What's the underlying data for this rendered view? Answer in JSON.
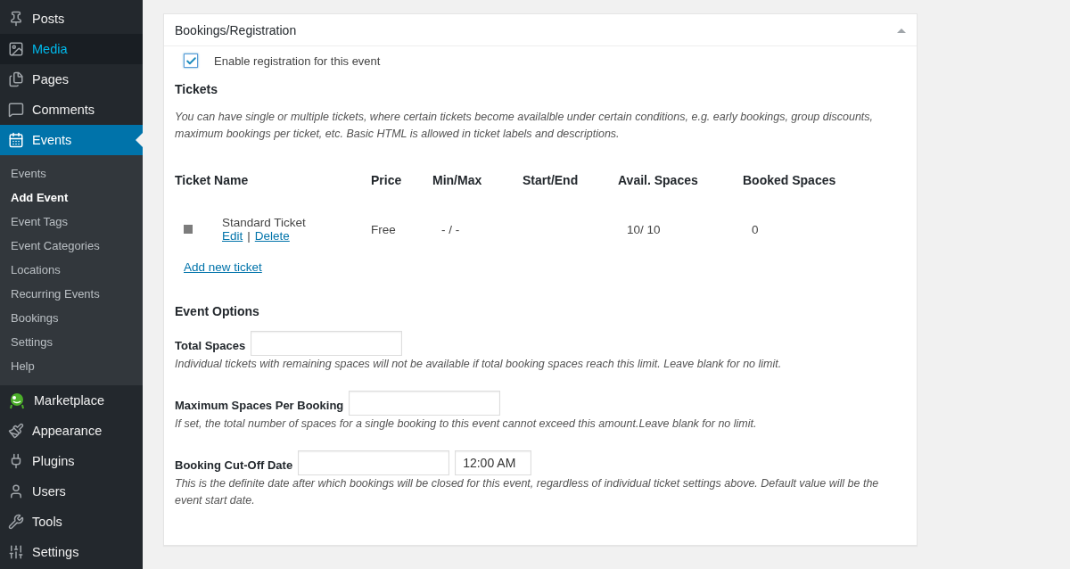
{
  "sidebar": {
    "items": [
      {
        "label": "Posts",
        "selected": false,
        "hovered": false
      },
      {
        "label": "Media",
        "selected": false,
        "hovered": true
      },
      {
        "label": "Pages",
        "selected": false,
        "hovered": false
      },
      {
        "label": "Comments",
        "selected": false,
        "hovered": false
      },
      {
        "label": "Events",
        "selected": true,
        "hovered": false,
        "children": [
          {
            "label": "Events",
            "selected": false
          },
          {
            "label": "Add Event",
            "selected": true
          },
          {
            "label": "Event Tags",
            "selected": false
          },
          {
            "label": "Event Categories",
            "selected": false
          },
          {
            "label": "Locations",
            "selected": false
          },
          {
            "label": "Recurring Events",
            "selected": false
          },
          {
            "label": "Bookings",
            "selected": false
          },
          {
            "label": "Settings",
            "selected": false
          },
          {
            "label": "Help",
            "selected": false
          }
        ]
      },
      {
        "label": "Marketplace",
        "selected": false,
        "hovered": false
      },
      {
        "label": "Appearance",
        "selected": false,
        "hovered": false
      },
      {
        "label": "Plugins",
        "selected": false,
        "hovered": false
      },
      {
        "label": "Users",
        "selected": false,
        "hovered": false
      },
      {
        "label": "Tools",
        "selected": false,
        "hovered": false
      },
      {
        "label": "Settings",
        "selected": false,
        "hovered": false
      }
    ]
  },
  "panel": {
    "title": "Bookings/Registration",
    "expanded": true,
    "enable_registration": {
      "label": "Enable registration for this event",
      "checked": true
    },
    "tickets": {
      "heading": "Tickets",
      "description": "You can have single or multiple tickets, where certain tickets become availalble under certain conditions, e.g. early bookings, group discounts, maximum bookings per ticket, etc. Basic HTML is allowed in ticket labels and descriptions.",
      "columns": [
        "Ticket Name",
        "Price",
        "Min/Max",
        "Start/End",
        "Avail. Spaces",
        "Booked Spaces"
      ],
      "rows": [
        {
          "name": "Standard Ticket",
          "edit": "Edit",
          "separator": "|",
          "delete": "Delete",
          "price": "Free",
          "min_max": "- / -",
          "avail": "10/ 10",
          "booked": "0"
        }
      ],
      "add_link": "Add new ticket"
    },
    "options": {
      "heading": "Event Options",
      "fields": [
        {
          "label": "Total Spaces",
          "inputs": [
            {
              "kind": "wide"
            }
          ],
          "help": "Individual tickets with remaining spaces will not be available if total booking spaces reach this limit. Leave blank for no limit."
        },
        {
          "label": "Maximum Spaces Per Booking",
          "inputs": [
            {
              "kind": "wide"
            }
          ],
          "help": "If set, the total number of spaces for a single booking to this event cannot exceed this amount.Leave blank for no limit."
        },
        {
          "label": "Booking Cut-Off Date",
          "inputs": [
            {
              "kind": "wide"
            },
            {
              "kind": "narrow",
              "value": "12:00 AM"
            }
          ],
          "help": "This is the definite date after which bookings will be closed for this event, regardless of individual ticket settings above. Default value will be the event start date."
        }
      ]
    }
  }
}
